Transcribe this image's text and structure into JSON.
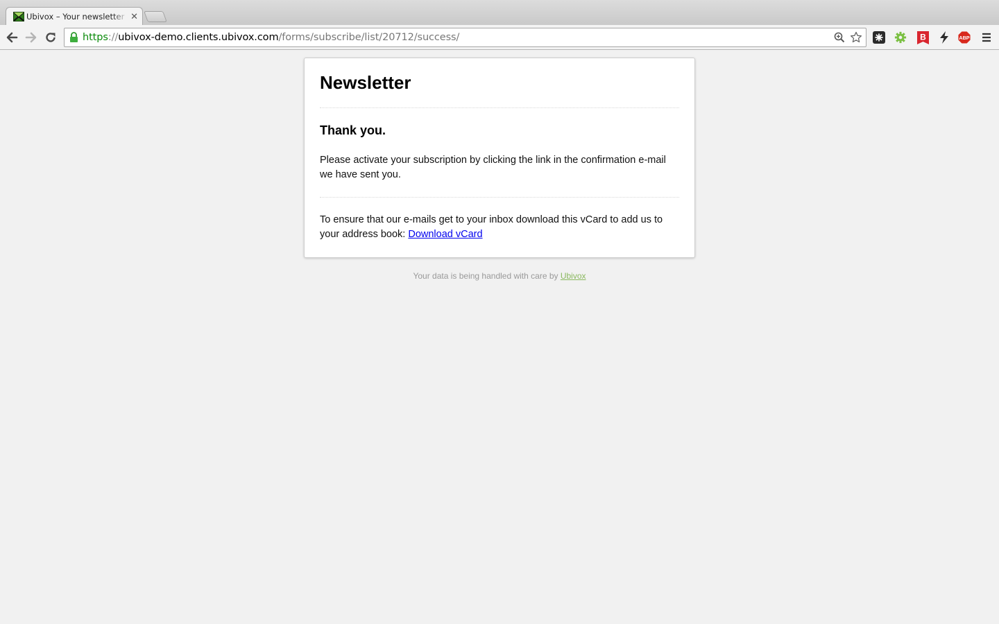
{
  "browser": {
    "tab_title": "Ubivox – Your newsletter c",
    "url": {
      "scheme": "https",
      "separator": "://",
      "host": "ubivox-demo.clients.ubivox.com",
      "path": "/forms/subscribe/list/20712/success/"
    },
    "extension_icons": [
      "grid-extension-icon",
      "gear-extension-icon",
      "b-extension-icon",
      "bolt-extension-icon",
      "abp-extension-icon",
      "menu-icon"
    ],
    "abp_label": "ABP",
    "b_label": "B"
  },
  "page": {
    "title": "Newsletter",
    "heading": "Thank you.",
    "message": "Please activate your subscription by clicking the link in the confirmation e-mail we have sent you.",
    "vcard_text": "To ensure that our e-mails get to your inbox download this vCard to add us to your address book: ",
    "vcard_link": "Download vCard"
  },
  "footer": {
    "text": "Your data is being handled with care by ",
    "link": "Ubivox"
  },
  "colors": {
    "secure_scheme": "#0a8a0a",
    "link": "#0000ee",
    "footer_link": "#8ab85e",
    "background": "#f1f1f1"
  }
}
